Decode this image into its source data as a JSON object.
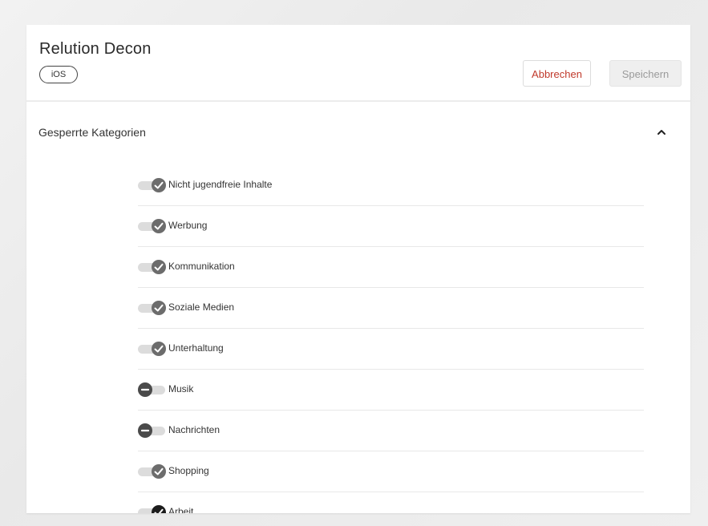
{
  "app": {
    "title": "Relution Decon",
    "platform_badge": "iOS"
  },
  "toolbar": {
    "cancel_label": "Abbrechen",
    "save_label": "Speichern"
  },
  "section": {
    "title": "Gesperrte Kategorien",
    "expanded": true
  },
  "colors": {
    "cancel_text": "#c0392b",
    "toggle_knob": "#6c6c6c",
    "toggle_track": "#dcdcdc"
  },
  "categories": [
    {
      "label": "Nicht jugendfreie Inhalte",
      "state": "allowed",
      "icon": "check-icon"
    },
    {
      "label": "Werbung",
      "state": "allowed",
      "icon": "check-icon"
    },
    {
      "label": "Kommunikation",
      "state": "allowed",
      "icon": "check-icon"
    },
    {
      "label": "Soziale Medien",
      "state": "allowed",
      "icon": "check-icon"
    },
    {
      "label": "Unterhaltung",
      "state": "allowed",
      "icon": "check-icon"
    },
    {
      "label": "Musik",
      "state": "blocked",
      "icon": "minus-icon"
    },
    {
      "label": "Nachrichten",
      "state": "blocked",
      "icon": "minus-icon"
    },
    {
      "label": "Shopping",
      "state": "allowed",
      "icon": "check-icon"
    },
    {
      "label": "Arbeit",
      "state": "partial",
      "icon": "check-icon"
    }
  ]
}
